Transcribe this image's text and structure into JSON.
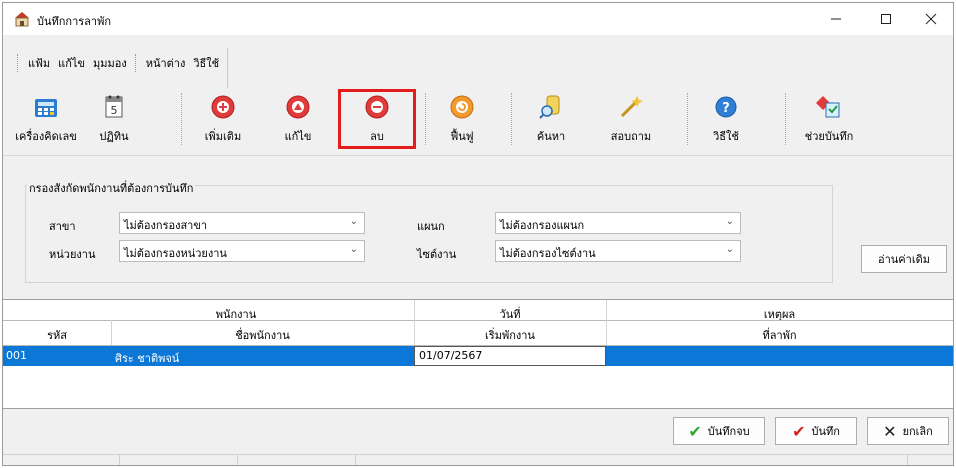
{
  "window": {
    "title": "บันทึกการลาพัก"
  },
  "menu": [
    "แฟ้ม",
    "แก้ไข",
    "มุมมอง",
    "หน้าต่าง",
    "วิธีใช้"
  ],
  "toolbar": {
    "calculator": "เครื่องคิดเลข",
    "calendar": "ปฏิทิน",
    "add": "เพิ่มเติม",
    "edit": "แก้ไข",
    "delete": "ลบ",
    "restore": "ฟื้นฟู",
    "search": "ค้นหา",
    "inquiry": "สอบถาม",
    "help": "วิธีใช้",
    "assist": "ช่วยบันทึก"
  },
  "filter": {
    "title": "กรองสังกัดพนักงานที่ต้องการบันทึก",
    "branch_label": "สาขา",
    "branch_value": "ไม่ต้องกรองสาขา",
    "department_label": "แผนก",
    "department_value": "ไม่ต้องกรองแผนก",
    "unit_label": "หน่วยงาน",
    "unit_value": "ไม่ต้องกรองหน่วยงาน",
    "site_label": "ไซต์งาน",
    "site_value": "ไม่ต้องกรองไซต์งาน",
    "reload_label": "อ่านค่าเดิม"
  },
  "grid": {
    "group_employee": "พนักงาน",
    "group_date": "วันที่",
    "group_reason": "เหตุผล",
    "col_code": "รหัส",
    "col_name": "ชื่อพนักงาน",
    "col_start": "เริ่มพักงาน",
    "col_reason": "ที่ลาพัก",
    "rows": [
      {
        "code": "001",
        "name": "ศิระ ชาติพจน์",
        "start": "01/07/2567",
        "reason": ""
      }
    ]
  },
  "actions": {
    "save_close": "บันทึกจบ",
    "save": "บันทึก",
    "cancel": "ยกเลิก"
  }
}
